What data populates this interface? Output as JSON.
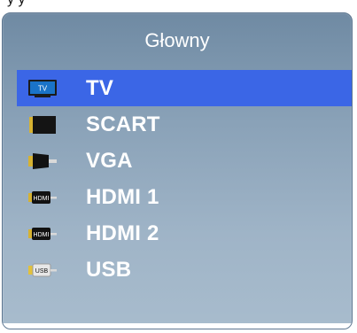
{
  "top_partial_text": "y   y",
  "menu": {
    "title": "Głowny",
    "items": [
      {
        "label": "TV",
        "icon": "tv-icon",
        "selected": true
      },
      {
        "label": "SCART",
        "icon": "scart-icon",
        "selected": false
      },
      {
        "label": "VGA",
        "icon": "vga-icon",
        "selected": false
      },
      {
        "label": "HDMI 1",
        "icon": "hdmi-icon",
        "icon_text": "HDMI",
        "selected": false
      },
      {
        "label": "HDMI 2",
        "icon": "hdmi-icon",
        "icon_text": "HDMI",
        "selected": false
      },
      {
        "label": "USB",
        "icon": "usb-icon",
        "icon_text": "USB",
        "selected": false
      }
    ]
  },
  "colors": {
    "selection": "#3b66e6",
    "panel_top": "#6f8aa3",
    "panel_bottom": "#a8bccd",
    "text": "#ffffff"
  }
}
